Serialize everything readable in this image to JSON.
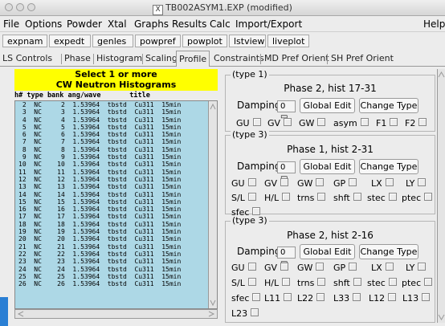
{
  "window": {
    "title": "TB002ASYM1.EXP (modified)"
  },
  "menu": [
    "File",
    "Options",
    "Powder",
    "Xtal",
    "Graphs",
    "Results",
    "Calc",
    "Import/Export",
    "Help"
  ],
  "toolbar": [
    "expnam",
    "expedt",
    "genles",
    "powpref",
    "powplot",
    "lstview",
    "liveplot"
  ],
  "tabs": [
    "LS Controls",
    "Phase",
    "Histogram",
    "Scaling",
    "Profile",
    "Constraints",
    "MD Pref Orient",
    "SH Pref Orient"
  ],
  "active_tab": "Profile",
  "histlist": {
    "header_line1": "Select 1 or more",
    "header_line2": "CW Neutron Histograms",
    "columns": "h# type bank ang/wave       title",
    "rows": [
      " 2  NC     2  1.53964  tbstd  Cu311  15min",
      " 3  NC     3  1.53964  tbstd  Cu311  15min",
      " 4  NC     4  1.53964  tbstd  Cu311  15min",
      " 5  NC     5  1.53964  tbstd  Cu311  15min",
      " 6  NC     6  1.53964  tbstd  Cu311  15min",
      " 7  NC     7  1.53964  tbstd  Cu311  15min",
      " 8  NC     8  1.53964  tbstd  Cu311  15min",
      " 9  NC     9  1.53964  tbstd  Cu311  15min",
      "10  NC    10  1.53964  tbstd  Cu311  15min",
      "11  NC    11  1.53964  tbstd  Cu311  15min",
      "12  NC    12  1.53964  tbstd  Cu311  15min",
      "13  NC    13  1.53964  tbstd  Cu311  15min",
      "14  NC    14  1.53964  tbstd  Cu311  15min",
      "15  NC    15  1.53964  tbstd  Cu311  15min",
      "16  NC    16  1.53964  tbstd  Cu311  15min",
      "17  NC    17  1.53964  tbstd  Cu311  15min",
      "18  NC    18  1.53964  tbstd  Cu311  15min",
      "19  NC    19  1.53964  tbstd  Cu311  15min",
      "20  NC    20  1.53964  tbstd  Cu311  15min",
      "21  NC    21  1.53964  tbstd  Cu311  15min",
      "22  NC    22  1.53964  tbstd  Cu311  15min",
      "23  NC    23  1.53964  tbstd  Cu311  15min",
      "24  NC    24  1.53964  tbstd  Cu311  15min",
      "25  NC    25  1.53964  tbstd  Cu311  15min",
      "26  NC    26  1.53964  tbstd  Cu311  15min"
    ]
  },
  "groups": [
    {
      "type": "(type 1)",
      "heading": "Phase 2, hist 17-31",
      "damping_label": "Damping",
      "damping_value": "0",
      "global_edit": "Global Edit",
      "change_type": "Change Type",
      "params": [
        "GU",
        "GV",
        "GW",
        "asym",
        "F1",
        "F2"
      ]
    },
    {
      "type": "(type 3)",
      "heading": "Phase 1, hist 2-31",
      "damping_label": "Damping",
      "damping_value": "0",
      "global_edit": "Global Edit",
      "change_type": "Change Type",
      "params": [
        "GU",
        "GV",
        "GW",
        "GP",
        "LX",
        "LY",
        "S/L",
        "H/L",
        "trns",
        "shft",
        "stec",
        "ptec",
        "sfec"
      ]
    },
    {
      "type": "(type 3)",
      "heading": "Phase 2, hist 2-16",
      "damping_label": "Damping",
      "damping_value": "0",
      "global_edit": "Global Edit",
      "change_type": "Change Type",
      "params": [
        "GU",
        "GV",
        "GW",
        "GP",
        "LX",
        "LY",
        "S/L",
        "H/L",
        "trns",
        "shft",
        "stec",
        "ptec",
        "sfec",
        "L11",
        "L22",
        "L33",
        "L12",
        "L13",
        "L23"
      ]
    }
  ],
  "colors": {
    "highlight_header": "#ffff00",
    "list_bg": "#add8e6"
  }
}
